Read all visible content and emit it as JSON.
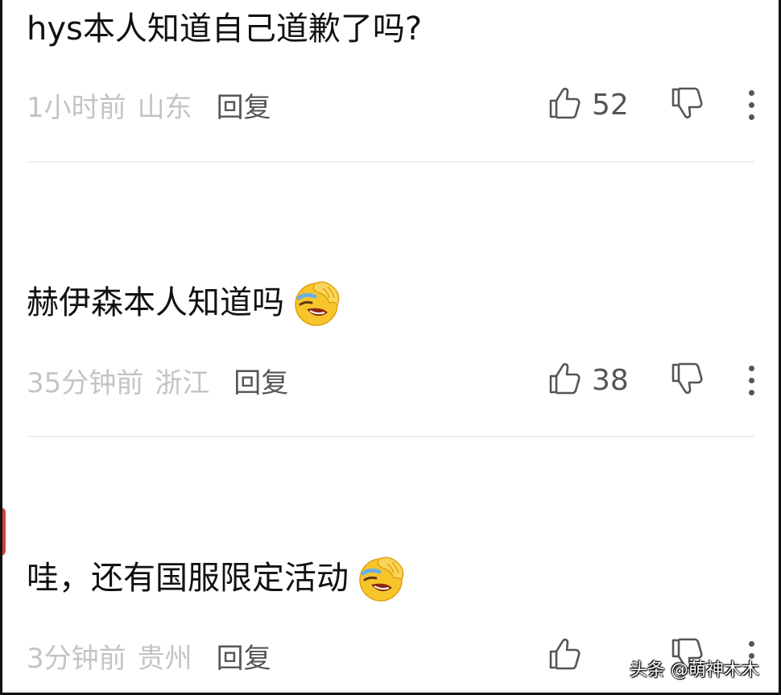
{
  "comments": [
    {
      "text": "hys本人知道自己道歉了吗?",
      "has_emoji": false,
      "time": "1小时前",
      "region": "山东",
      "reply_label": "回复",
      "likes": "52"
    },
    {
      "text": "赫伊森本人知道吗",
      "has_emoji": true,
      "emoji_icon": "facepalm-laugh-emoji-icon",
      "time": "35分钟前",
      "region": "浙江",
      "reply_label": "回复",
      "likes": "38"
    },
    {
      "text": "哇，还有国服限定活动",
      "has_emoji": true,
      "emoji_icon": "facepalm-laugh-emoji-icon",
      "time": "3分钟前",
      "region": "贵州",
      "reply_label": "回复",
      "likes": ""
    }
  ],
  "watermark": "头条 @萌神木木",
  "colors": {
    "text_primary": "#111111",
    "text_meta": "#c4c4c4",
    "text_action": "#555555",
    "divider": "#eeeeee"
  },
  "icons": {
    "like": "thumbs-up-icon",
    "dislike": "thumbs-down-icon",
    "more": "more-vertical-icon"
  }
}
